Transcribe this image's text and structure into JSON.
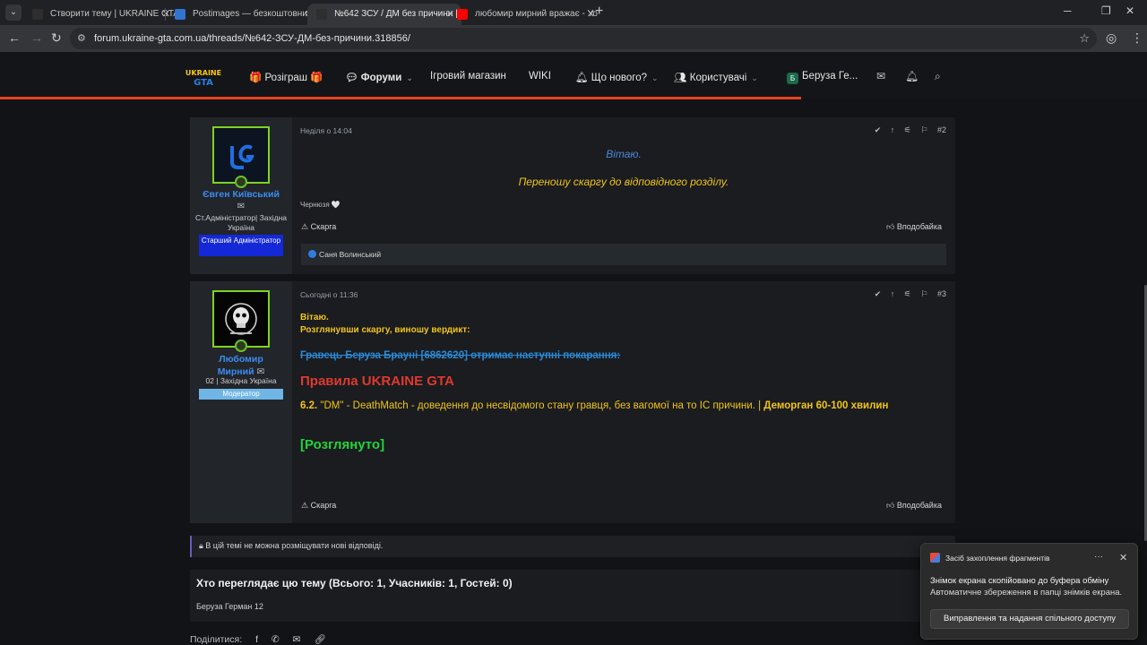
{
  "browser": {
    "tabs": [
      {
        "title": "Створити тему | UKRAINE GTA",
        "icon_color": "#2e2e2e",
        "active": false
      },
      {
        "title": "Postimages — безкоштовний х",
        "icon_color": "#2f74d0",
        "active": false
      },
      {
        "title": "№642 ЗСУ / ДМ без причини |",
        "icon_color": "#2e2e2e",
        "active": true
      },
      {
        "title": "любомир мирний вражає - Yo",
        "icon_color": "#ff0000",
        "active": false
      }
    ],
    "url": "forum.ukraine-gta.com.ua/threads/№642-ЗСУ-ДМ-без-причини.318856/"
  },
  "header": {
    "logo_text": "UKRAINE GTA",
    "nav": {
      "giveaway": "🎁 Розіграш 🎁",
      "forums": "Форуми",
      "shop": "Ігровий магазин",
      "wiki": "WIKI",
      "whats_new": "Що нового?",
      "users": "Користувачі",
      "account_badge": "Б",
      "account": "Беруза Ге..."
    }
  },
  "posts": [
    {
      "author": "Євген Київський",
      "author_color": "#3b8df0",
      "title": "Ст.Адміністратор| Західна Україна",
      "banner": "Старший Адміністратор",
      "banner_bg": "#1428d8",
      "banner_color": "#ffffff",
      "date": "Неділя о 14:04",
      "number": "#2",
      "line1": "Вітаю.",
      "line2": "Переношу скаргу до відповідного розділу.",
      "signature": "Чернюзя 🤍",
      "report": "Скарга",
      "like": "Вподобайка",
      "reactions": "Саня Волинський"
    },
    {
      "author": "Любомир Мирний",
      "author_color": "#3b8df0",
      "title": "02 | Західна Україна",
      "banner": "Модератор",
      "banner_bg": "#6fb6e6",
      "banner_color": "#ffffff",
      "date": "Сьогодні о 11:36",
      "number": "#3",
      "greeting": "Вітаю.",
      "verdict_intro": "Розглянувши скаргу, виношу вердикт:",
      "punish": "Гравець Беруза Брауні [6862620] отримає наступні покарання:",
      "rules_title": "Правила UKRAINE GTA",
      "rule_number": "6.2.",
      "rule_text": " \"DM\" - DeathMatch - доведення до несвідомого стану гравця, без вагомої на то IC причини. | ",
      "rule_penalty": "Деморган 60-100 хвилин",
      "status": "[Розглянуто]",
      "report": "Скарга",
      "like": "Вподобайка"
    }
  ],
  "thread_closed_note": "В цій темі не можна розміщувати нові відповіді.",
  "viewers": {
    "title": "Хто переглядає цю тему (Всього: 1, Учасників: 1, Гостей: 0)",
    "list": "Беруза Герман 12"
  },
  "share_label": "Поділитися:",
  "toast": {
    "app": "Засіб захоплення фрагментів",
    "title": "Знімок екрана скопійовано до буфера обміну",
    "body": "Автоматичне збереження в папці знімків екрана.",
    "button": "Виправлення та надання спільного доступу"
  },
  "colors": {
    "accent_orange": "#e8431f",
    "verdict_yellow": "#f0c419",
    "rules_red": "#e0392e",
    "status_green": "#22d33a",
    "punish_blue": "#2a8ad6",
    "greeting_blue": "#4b86d8"
  }
}
